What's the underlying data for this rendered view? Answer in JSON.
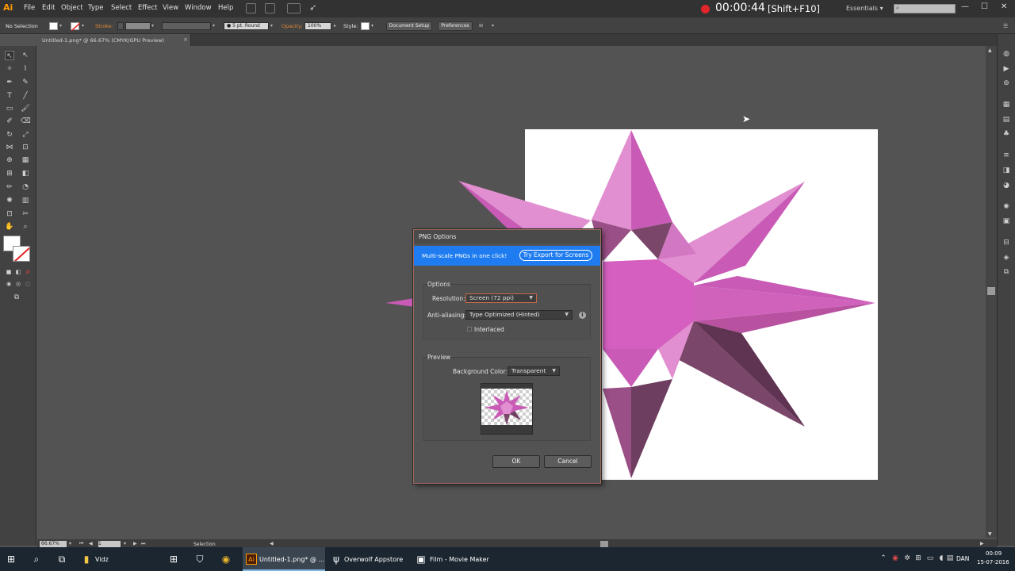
{
  "menubar": {
    "app_logo": "Ai",
    "items": [
      "File",
      "Edit",
      "Object",
      "Type",
      "Select",
      "Effect",
      "View",
      "Window",
      "Help"
    ],
    "recording_time": "00:00:44",
    "recording_shortcut": "[Shift+F10]",
    "workspace": "Essentials",
    "workspace_caret": "▾",
    "minimize": "—",
    "maximize": "☐",
    "close": "✕"
  },
  "controlbar": {
    "selection_state": "No Selection",
    "stroke_label": "Stroke:",
    "brush": "5 pt. Round",
    "opacity_label": "Opacity:",
    "opacity_value": "100%",
    "style_label": "Style:",
    "document_setup": "Document Setup",
    "preferences": "Preferences"
  },
  "document_tab": {
    "label": "Untitled-1.png* @ 66.67% (CMYK/GPU Preview)",
    "close": "×"
  },
  "statusbar": {
    "zoom": "66.67%",
    "page": "1",
    "tool": "Selection"
  },
  "dialog": {
    "title": "PNG Options",
    "banner_text": "Multi-scale PNGs in one click!",
    "banner_button": "Try Export for Screens",
    "options_heading": "Options",
    "resolution_label": "Resolution:",
    "resolution_value": "Screen (72 ppi)",
    "antialiasing_label": "Anti-aliasing:",
    "antialiasing_value": "Type Optimized (Hinted)",
    "interlaced_label": "Interlaced",
    "interlaced_checked": false,
    "preview_heading": "Preview",
    "background_label": "Background Color:",
    "background_value": "Transparent",
    "ok": "OK",
    "cancel": "Cancel",
    "info_glyph": "i"
  },
  "taskbar": {
    "apps": [
      {
        "label": "Vidz",
        "icon": "folder-icon"
      },
      {
        "label": "Untitled-1.png* @ ...",
        "icon": "illustrator-icon",
        "active": true
      },
      {
        "label": "Overwolf Appstore",
        "icon": "overwolf-icon"
      },
      {
        "label": "Film - Movie Maker",
        "icon": "movie-maker-icon"
      }
    ],
    "language": "DAN",
    "time": "00:09",
    "date": "15-07-2016"
  },
  "colors": {
    "accent": "#1e7cf0",
    "record": "#e0262b",
    "star_light": "#e18fd0",
    "star_mid": "#c95bb6",
    "star_dark": "#6e3e60"
  }
}
